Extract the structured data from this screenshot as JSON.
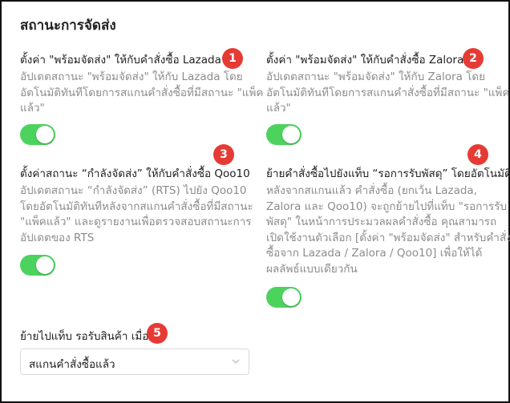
{
  "page": {
    "title": "สถานะการจัดส่ง"
  },
  "sections": [
    {
      "title": "ตั้งค่า \"พร้อมจัดส่ง\" ให้กับคำสั่งซื้อ Lazada",
      "desc_lines": [
        "อัปเดตสถานะ \"พร้อมจัดส่ง\" ให้กับ Lazada โดย",
        "อัตโนมัติทันทีโดยการสแกนคำสั่งซื้อที่มีสถานะ \"แพ็ค",
        "แล้ว\""
      ],
      "toggle_on": true
    },
    {
      "title": "ตั้งค่า \"พร้อมจัดส่ง\" ให้กับคำสั่งซื้อ Zalora",
      "desc_lines": [
        "อัปเดตสถานะ \"พร้อมจัดส่ง\" ให้กับ Zalora โดย",
        "อัตโนมัติทันทีโดยการสแกนคำสั่งซื้อที่มีสถานะ \"แพ็ค",
        "แล้ว\""
      ],
      "toggle_on": true
    },
    {
      "title": "ตั้งค่าสถานะ “กำลังจัดส่ง” ให้กับคำสั่งซื้อ Qoo10",
      "desc_lines": [
        "อัปเดตสถานะ “กำลังจัดส่ง” (RTS) ไปยัง Qoo10",
        "โดยอัตโนมัติทันทีหลังจากสแกนคำสั่งซื้อที่มีสถานะ",
        "\"แพ็คแล้ว\" และดูรายงานเพื่อตรวจสอบสถานะการ",
        "อัปเดตของ RTS"
      ],
      "toggle_on": true
    },
    {
      "title": "ย้ายคำสั่งซื้อไปยังแท็บ “รอการรับพัสดุ” โดยอัตโนมัติ",
      "desc_lines": [
        "หลังจากสแกนแล้ว คำสั่งซื้อ (ยกเว้น Lazada,",
        "Zalora และ Qoo10) จะถูกย้ายไปที่แท็บ \"รอการรับ",
        "พัสดุ\" ในหน้าการประมวลผลคำสั่งซื้อ คุณสามารถ",
        "เปิดใช้งานตัวเลือก [ตั้งค่า \"พร้อมจัดส่ง\" สำหรับคำสั่ง",
        "ซื้อจาก Lazada / Zalora / Qoo10] เพื่อให้ได้",
        "ผลลัพธ์แบบเดียวกัน"
      ],
      "toggle_on": true
    }
  ],
  "move_tab": {
    "label": "ย้ายไปแท็บ รอรับสินค้า เมื่อ",
    "selected": "สแกนคำสั่งซื้อแล้ว"
  },
  "badges": [
    "1",
    "2",
    "3",
    "4",
    "5"
  ],
  "colors": {
    "toggle_on": "#4cd35e",
    "badge": "#e63b35",
    "description": "#8c8c8c"
  },
  "icons": {
    "select_arrow": "chevron-down-icon"
  }
}
